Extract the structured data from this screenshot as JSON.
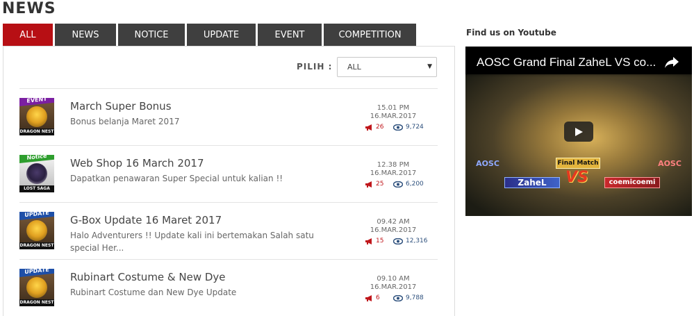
{
  "header": {
    "title": "NEWS"
  },
  "tabs": [
    {
      "label": "ALL",
      "active": true
    },
    {
      "label": "NEWS",
      "active": false
    },
    {
      "label": "NOTICE",
      "active": false
    },
    {
      "label": "UPDATE",
      "active": false
    },
    {
      "label": "EVENT",
      "active": false
    },
    {
      "label": "COMPETITION",
      "active": false
    }
  ],
  "filter": {
    "label": "PILIH :",
    "selected": "ALL"
  },
  "items": [
    {
      "category": "EVENT",
      "category_color": "#7b1fa2",
      "game": "DRAGON NEST",
      "title": "March Super Bonus",
      "description": "Bonus belanja Maret 2017",
      "time": "15.01 PM",
      "date": "16.MAR.2017",
      "likes": "26",
      "views": "9,724"
    },
    {
      "category": "Notice",
      "category_color": "#2e9e2e",
      "game": "LOST SAGA",
      "title": "Web Shop 16 March 2017",
      "description": "Dapatkan penawaran Super Special untuk kalian !!",
      "time": "12.38 PM",
      "date": "16.MAR.2017",
      "likes": "25",
      "views": "6,200"
    },
    {
      "category": "UPDATE",
      "category_color": "#1e4fa8",
      "game": "DRAGON NEST",
      "title": "G-Box Update 16 Maret 2017",
      "description": "Halo Adventurers !! Update kali ini bertemakan Salah satu special Her...",
      "time": "09.42 AM",
      "date": "16.MAR.2017",
      "likes": "15",
      "views": "12,316"
    },
    {
      "category": "UPDATE",
      "category_color": "#1e4fa8",
      "game": "DRAGON NEST",
      "title": "Rubinart Costume & New Dye",
      "description": "Rubinart Costume dan New Dye Update",
      "time": "09.10 AM",
      "date": "16.MAR.2017",
      "likes": "6",
      "views": "9,788"
    }
  ],
  "youtube": {
    "heading": "Find us on Youtube",
    "video_title": "AOSC Grand Final ZaheL VS co...",
    "banner": "Final Match",
    "vs": "VS",
    "team_left": "ZaheL",
    "team_right": "coemicoemi",
    "logo_left": "AOSC",
    "logo_right": "AOSC"
  },
  "colors": {
    "accent": "#b70f14",
    "tab_bg": "#3f3f3f",
    "views": "#2c4f7c"
  }
}
